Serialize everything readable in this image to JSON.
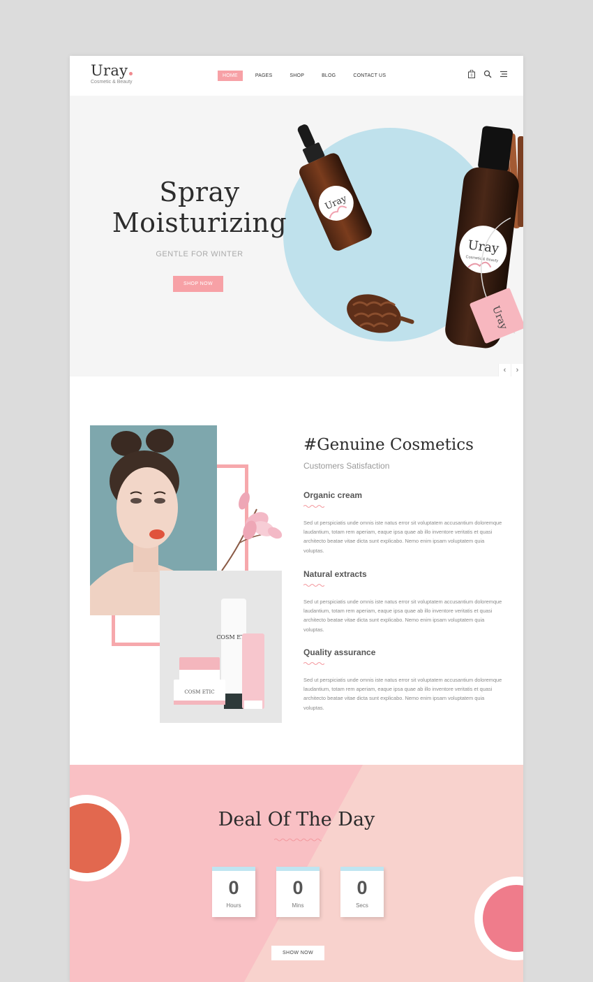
{
  "header": {
    "logo_name": "Uray",
    "logo_tagline": "Cosmetic & Beauty",
    "nav": [
      "HOME",
      "PAGES",
      "SHOP",
      "BLOG",
      "CONTACT US"
    ],
    "active_nav": "HOME",
    "cart_count": "0"
  },
  "hero": {
    "title_line1": "Spray",
    "title_line2": "Moisturizing",
    "subtitle": "GENTLE FOR WINTER",
    "button": "SHOP NOW",
    "bottle_label_brand": "Uray",
    "bottle_label_tagline": "Cosmetic & Beauty",
    "tag_label": "Uray",
    "prev": "‹",
    "next": "›"
  },
  "about": {
    "title": "#Genuine Cosmetics",
    "subtitle": "Customers Satisfaction",
    "features": [
      {
        "title": "Organic cream",
        "text": "Sed ut perspiciatis unde omnis iste natus error sit voluptatem accusantium doloremque laudantium, totam rem aperiam, eaque ipsa quae ab illo inventore veritatis et quasi architecto beatae vitae dicta sunt explicabo. Nemo enim ipsam voluptatem quia voluptas."
      },
      {
        "title": "Natural extracts",
        "text": "Sed ut perspiciatis unde omnis iste natus error sit voluptatem accusantium doloremque laudantium, totam rem aperiam, eaque ipsa quae ab illo inventore veritatis et quasi architecto beatae vitae dicta sunt explicabo. Nemo enim ipsam voluptatem quia voluptas."
      },
      {
        "title": "Quality assurance",
        "text": "Sed ut perspiciatis unde omnis iste natus error sit voluptatem accusantium doloremque laudantium, totam rem aperiam, eaque ipsa quae ab illo inventore veritatis et quasi architecto beatae vitae dicta sunt explicabo. Nemo enim ipsam voluptatem quia voluptas."
      }
    ],
    "tube_label": "COSM ETIC",
    "jar_label": "COSM ETIC"
  },
  "deal": {
    "title": "Deal Of The Day",
    "counters": [
      {
        "value": "0",
        "label": "Hours"
      },
      {
        "value": "0",
        "label": "Mins"
      },
      {
        "value": "0",
        "label": "Secs"
      }
    ],
    "button": "SHOW NOW"
  },
  "colors": {
    "accent_pink": "#f7a1a6",
    "hero_bg": "#f5f5f5",
    "circle_blue": "#bfe1ec",
    "deal_pink": "#f9c0c4",
    "counter_top": "#bfe5f1"
  },
  "icons": {
    "cart": "shopping-bag-icon",
    "search": "search-icon",
    "menu": "hamburger-menu-icon"
  }
}
